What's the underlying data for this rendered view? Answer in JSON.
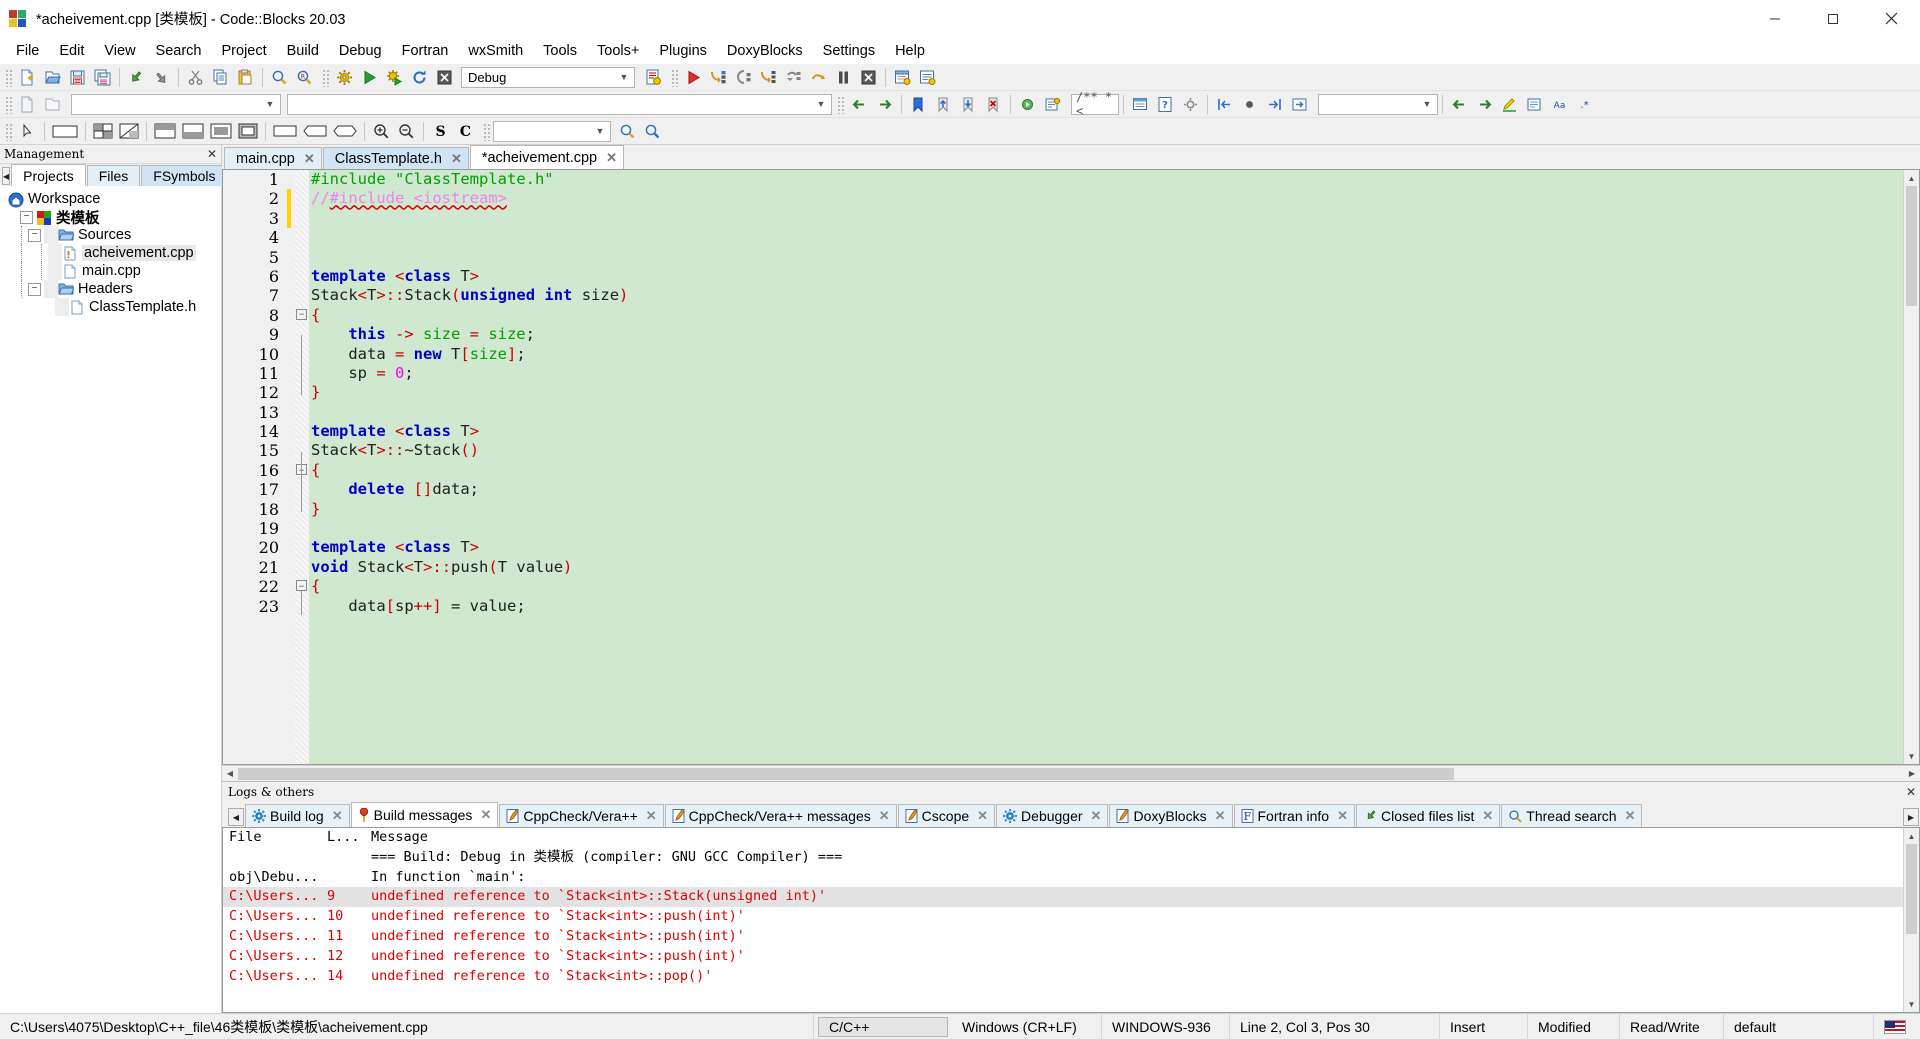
{
  "window": {
    "title": "*acheivement.cpp [类模板] - Code::Blocks 20.03",
    "minimize_label": "minimize-icon",
    "maximize_label": "maximize-icon",
    "close_label": "close-icon"
  },
  "menubar": {
    "items": [
      {
        "label": "File"
      },
      {
        "label": "Edit"
      },
      {
        "label": "View"
      },
      {
        "label": "Search"
      },
      {
        "label": "Project"
      },
      {
        "label": "Build"
      },
      {
        "label": "Debug"
      },
      {
        "label": "Fortran"
      },
      {
        "label": "wxSmith"
      },
      {
        "label": "Tools"
      },
      {
        "label": "Tools+"
      },
      {
        "label": "Plugins"
      },
      {
        "label": "DoxyBlocks"
      },
      {
        "label": "Settings"
      },
      {
        "label": "Help"
      }
    ]
  },
  "toolbar": {
    "build_target": "Debug",
    "search_placeholder": "",
    "search_value": "",
    "goto_value": "",
    "icons": [
      "new-file-icon",
      "open-file-icon",
      "save-icon",
      "save-all-icon",
      "undo-icon",
      "redo-icon",
      "cut-icon",
      "copy-icon",
      "paste-icon",
      "find-icon",
      "replace-icon",
      "build-icon",
      "run-icon",
      "build-and-run-icon",
      "rebuild-icon",
      "abort-icon",
      "build-target-select",
      "build-log-icon",
      "debug-continue-icon",
      "step-into-icon",
      "step-out-icon",
      "next-line-icon",
      "next-instruction-icon",
      "step-over-icon",
      "break-debugger-icon",
      "stop-debugger-icon",
      "debugging-windows-icon",
      "various-info-icon"
    ]
  },
  "management": {
    "panel_title": "Management",
    "close_icon": "close-icon",
    "scroll_left_icon": "scroll-left-icon",
    "scroll_right_icon": "scroll-right-icon",
    "tabs": [
      {
        "label": "Projects",
        "active": true
      },
      {
        "label": "Files",
        "active": false
      },
      {
        "label": "FSymbols",
        "active": false,
        "highlight": true
      }
    ],
    "tree": [
      {
        "label": "Workspace",
        "depth": 0,
        "icon": "workspace-icon",
        "twist": ""
      },
      {
        "label": "类模板",
        "depth": 1,
        "icon": "project-icon",
        "twist": "-",
        "bold": true
      },
      {
        "label": "Sources",
        "depth": 2,
        "icon": "folder-icon",
        "twist": "-"
      },
      {
        "label": "acheivement.cpp",
        "depth": 3,
        "icon": "file-modified-icon",
        "twist": "",
        "selected": true
      },
      {
        "label": "main.cpp",
        "depth": 3,
        "icon": "file-icon",
        "twist": ""
      },
      {
        "label": "Headers",
        "depth": 2,
        "icon": "folder-icon",
        "twist": "-"
      },
      {
        "label": "ClassTemplate.h",
        "depth": 3,
        "icon": "file-icon",
        "twist": ""
      }
    ]
  },
  "editor": {
    "tabs": [
      {
        "label": "main.cpp",
        "active": false,
        "close": "x"
      },
      {
        "label": "ClassTemplate.h",
        "active": false,
        "highlight": true,
        "close": "x"
      },
      {
        "label": "*acheivement.cpp",
        "active": true,
        "close": "x"
      }
    ],
    "background_color": "#cfe8cf",
    "first_line": 1,
    "lines": [
      {
        "n": 1,
        "tokens": [
          {
            "t": "#include ",
            "c": "grn"
          },
          {
            "t": "\"ClassTemplate.h\"",
            "c": "grn"
          }
        ]
      },
      {
        "n": 2,
        "tokens": [
          {
            "t": "//",
            "c": "cmt"
          },
          {
            "t": "#include <iostream>",
            "c": "cmt-sq"
          }
        ],
        "caret": true
      },
      {
        "n": 3,
        "tokens": [],
        "caret_mark": true
      },
      {
        "n": 4,
        "tokens": []
      },
      {
        "n": 5,
        "tokens": []
      },
      {
        "n": 6,
        "tokens": [
          {
            "t": "template ",
            "c": "kw"
          },
          {
            "t": "<",
            "c": "op"
          },
          {
            "t": "class ",
            "c": "kw"
          },
          {
            "t": "T",
            "c": "pln"
          },
          {
            "t": ">",
            "c": "op"
          }
        ]
      },
      {
        "n": 7,
        "tokens": [
          {
            "t": "Stack",
            "c": "pln"
          },
          {
            "t": "<",
            "c": "op"
          },
          {
            "t": "T",
            "c": "pln"
          },
          {
            "t": ">",
            "c": "op"
          },
          {
            "t": "::",
            "c": "op"
          },
          {
            "t": "Stack",
            "c": "pln"
          },
          {
            "t": "(",
            "c": "op"
          },
          {
            "t": "unsigned int ",
            "c": "kw"
          },
          {
            "t": "size",
            "c": "pln"
          },
          {
            "t": ")",
            "c": "op"
          }
        ]
      },
      {
        "n": 8,
        "tokens": [
          {
            "t": "{",
            "c": "op"
          }
        ],
        "fold": "open"
      },
      {
        "n": 9,
        "tokens": [
          {
            "t": "    ",
            "c": "pln"
          },
          {
            "t": "this",
            "c": "kw"
          },
          {
            "t": " -> ",
            "c": "op"
          },
          {
            "t": "size",
            "c": "grn"
          },
          {
            "t": " = ",
            "c": "op"
          },
          {
            "t": "size",
            "c": "grn"
          },
          {
            "t": ";",
            "c": "pln"
          }
        ]
      },
      {
        "n": 10,
        "tokens": [
          {
            "t": "    data ",
            "c": "pln"
          },
          {
            "t": "= ",
            "c": "op"
          },
          {
            "t": "new ",
            "c": "kw"
          },
          {
            "t": "T",
            "c": "pln"
          },
          {
            "t": "[",
            "c": "op"
          },
          {
            "t": "size",
            "c": "grn"
          },
          {
            "t": "]",
            "c": "op"
          },
          {
            "t": ";",
            "c": "pln"
          }
        ]
      },
      {
        "n": 11,
        "tokens": [
          {
            "t": "    sp ",
            "c": "pln"
          },
          {
            "t": "= ",
            "c": "op"
          },
          {
            "t": "0",
            "c": "num"
          },
          {
            "t": ";",
            "c": "pln"
          }
        ]
      },
      {
        "n": 12,
        "tokens": [
          {
            "t": "}",
            "c": "op"
          }
        ],
        "fold": "end"
      },
      {
        "n": 13,
        "tokens": []
      },
      {
        "n": 14,
        "tokens": [
          {
            "t": "template ",
            "c": "kw"
          },
          {
            "t": "<",
            "c": "op"
          },
          {
            "t": "class ",
            "c": "kw"
          },
          {
            "t": "T",
            "c": "pln"
          },
          {
            "t": ">",
            "c": "op"
          }
        ]
      },
      {
        "n": 15,
        "tokens": [
          {
            "t": "Stack",
            "c": "pln"
          },
          {
            "t": "<",
            "c": "op"
          },
          {
            "t": "T",
            "c": "pln"
          },
          {
            "t": ">",
            "c": "op"
          },
          {
            "t": "::",
            "c": "op"
          },
          {
            "t": "~Stack",
            "c": "pln"
          },
          {
            "t": "()",
            "c": "op"
          }
        ]
      },
      {
        "n": 16,
        "tokens": [
          {
            "t": "{",
            "c": "op"
          }
        ],
        "fold": "open"
      },
      {
        "n": 17,
        "tokens": [
          {
            "t": "    ",
            "c": "pln"
          },
          {
            "t": "delete ",
            "c": "kw"
          },
          {
            "t": "[]",
            "c": "op"
          },
          {
            "t": "data;",
            "c": "pln"
          }
        ]
      },
      {
        "n": 18,
        "tokens": [
          {
            "t": "}",
            "c": "op"
          }
        ],
        "fold": "end"
      },
      {
        "n": 19,
        "tokens": []
      },
      {
        "n": 20,
        "tokens": [
          {
            "t": "template ",
            "c": "kw"
          },
          {
            "t": "<",
            "c": "op"
          },
          {
            "t": "class ",
            "c": "kw"
          },
          {
            "t": "T",
            "c": "pln"
          },
          {
            "t": ">",
            "c": "op"
          }
        ]
      },
      {
        "n": 21,
        "tokens": [
          {
            "t": "void ",
            "c": "kw"
          },
          {
            "t": "Stack",
            "c": "pln"
          },
          {
            "t": "<",
            "c": "op"
          },
          {
            "t": "T",
            "c": "pln"
          },
          {
            "t": ">",
            "c": "op"
          },
          {
            "t": "::",
            "c": "op"
          },
          {
            "t": "push",
            "c": "pln"
          },
          {
            "t": "(",
            "c": "op"
          },
          {
            "t": "T value",
            "c": "pln"
          },
          {
            "t": ")",
            "c": "op"
          }
        ]
      },
      {
        "n": 22,
        "tokens": [
          {
            "t": "{",
            "c": "op"
          }
        ],
        "fold": "open"
      },
      {
        "n": 23,
        "tokens": [
          {
            "t": "    data",
            "c": "pln"
          },
          {
            "t": "[",
            "c": "op"
          },
          {
            "t": "sp",
            "c": "pln"
          },
          {
            "t": "++",
            "c": "op"
          },
          {
            "t": "]",
            "c": "op"
          },
          {
            "t": " = value;",
            "c": "pln"
          }
        ]
      }
    ]
  },
  "logs": {
    "panel_title": "Logs & others",
    "close_icon": "close-icon",
    "scroll_left_icon": "scroll-left-icon",
    "scroll_right_icon": "scroll-right-icon",
    "tabs": [
      {
        "label": "Build log",
        "icon": "gear-icon",
        "active": false
      },
      {
        "label": "Build messages",
        "icon": "pin-icon",
        "active": true
      },
      {
        "label": "CppCheck/Vera++",
        "icon": "pencil-icon",
        "active": false
      },
      {
        "label": "CppCheck/Vera++ messages",
        "icon": "pencil-icon",
        "active": false,
        "highlight": true
      },
      {
        "label": "Cscope",
        "icon": "pencil-icon",
        "active": false
      },
      {
        "label": "Debugger",
        "icon": "gear-icon",
        "active": false
      },
      {
        "label": "DoxyBlocks",
        "icon": "pencil-icon",
        "active": false
      },
      {
        "label": "Fortran info",
        "icon": "fortran-icon",
        "active": false
      },
      {
        "label": "Closed files list",
        "icon": "undo-icon",
        "active": false
      },
      {
        "label": "Thread search",
        "icon": "search-icon",
        "active": false
      }
    ],
    "columns": [
      "File",
      "L...",
      "Message"
    ],
    "rows": [
      {
        "file": "",
        "line": "",
        "message": "=== Build: Debug in 类模板 (compiler: GNU GCC Compiler) ===",
        "error": false
      },
      {
        "file": "obj\\Debu...",
        "line": "",
        "message": "In function `main':",
        "error": false
      },
      {
        "file": "C:\\Users...",
        "line": "9",
        "message": "undefined reference to `Stack<int>::Stack(unsigned int)'",
        "error": true,
        "selected": true
      },
      {
        "file": "C:\\Users...",
        "line": "10",
        "message": "undefined reference to `Stack<int>::push(int)'",
        "error": true
      },
      {
        "file": "C:\\Users...",
        "line": "11",
        "message": "undefined reference to `Stack<int>::push(int)'",
        "error": true
      },
      {
        "file": "C:\\Users...",
        "line": "12",
        "message": "undefined reference to `Stack<int>::push(int)'",
        "error": true
      },
      {
        "file": "C:\\Users...",
        "line": "14",
        "message": "undefined reference to `Stack<int>::pop()'",
        "error": true
      }
    ]
  },
  "statusbar": {
    "path": "C:\\Users\\4075\\Desktop\\C++_file\\46类模板\\类模板\\acheivement.cpp",
    "language": "C/C++",
    "eol": "Windows (CR+LF)",
    "encoding": "WINDOWS-936",
    "position": "Line 2, Col 3, Pos 30",
    "insert_mode": "Insert",
    "modified": "Modified",
    "access": "Read/Write",
    "personality": "default",
    "keyboard_flag": "us-flag-icon"
  },
  "colors": {
    "editor_bg": "#cfe8cf",
    "keyword": "#0000c8",
    "string": "#1f9c1f",
    "comment": "#ee82ee",
    "number": "#ff00ff",
    "operator": "#cc0000",
    "error_text": "#e00000",
    "accent": "#cfe5f6"
  }
}
